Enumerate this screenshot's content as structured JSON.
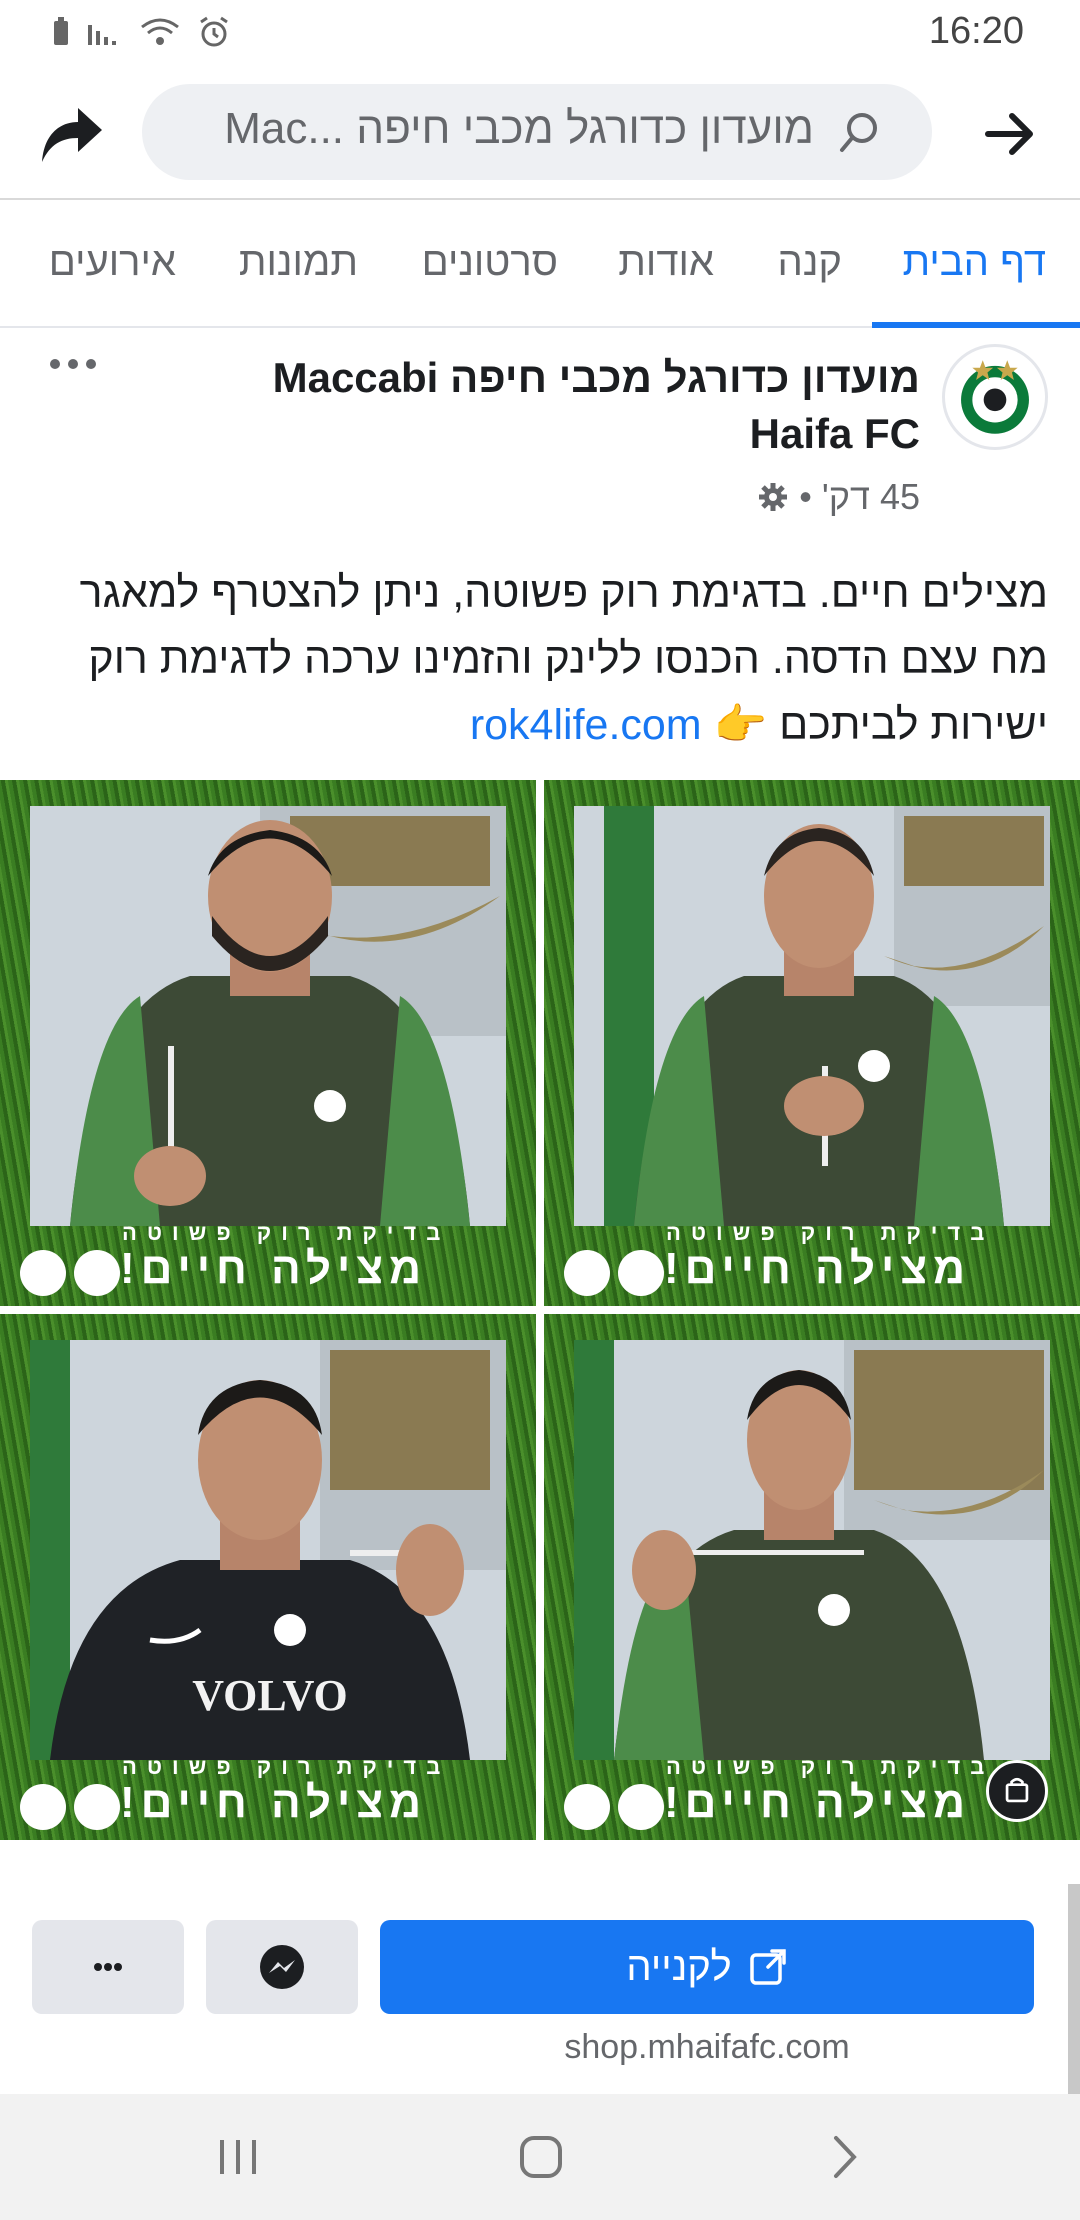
{
  "status_bar": {
    "time": "16:20"
  },
  "search": {
    "query": "מועדון כדורגל מכבי חיפה ...Mac"
  },
  "tabs": [
    {
      "label": "דף הבית",
      "active": true
    },
    {
      "label": "קנה",
      "active": false
    },
    {
      "label": "אודות",
      "active": false
    },
    {
      "label": "סרטונים",
      "active": false
    },
    {
      "label": "תמונות",
      "active": false
    },
    {
      "label": "אירועים",
      "active": false
    }
  ],
  "post": {
    "page_name": "מועדון כדורגל מכבי חיפה Maccabi Haifa FC",
    "time": "45 דק'",
    "separator": "•",
    "text": "מצילים חיים. בדגימת רוק פשוטה, ניתן להצטרף למאגר מח עצם הדסה. הכנסו ללינק והזמינו ערכה לדגימת רוק ישירות לביתכם",
    "emoji": "👉",
    "link": "rok4life.com"
  },
  "images": [
    {
      "caption_small": "בדיקת רוק פשוטה",
      "caption_big": "מצילה חיים!",
      "jersey_text": ""
    },
    {
      "caption_small": "בדיקת רוק פשוטה",
      "caption_big": "מצילה חיים!",
      "jersey_text": ""
    },
    {
      "caption_small": "בדיקת רוק פשוטה",
      "caption_big": "מצילה חיים!",
      "jersey_text": ""
    },
    {
      "caption_small": "בדיקת רוק פשוטה",
      "caption_big": "מצילה חיים!",
      "jersey_text": "VOLVO"
    }
  ],
  "actions": {
    "buy_label": "לקנייה",
    "shop_url": "shop.mhaifafc.com"
  },
  "colors": {
    "accent": "#1877f2",
    "grass": "#2f6b1f",
    "shirt": "#3d4a36"
  }
}
